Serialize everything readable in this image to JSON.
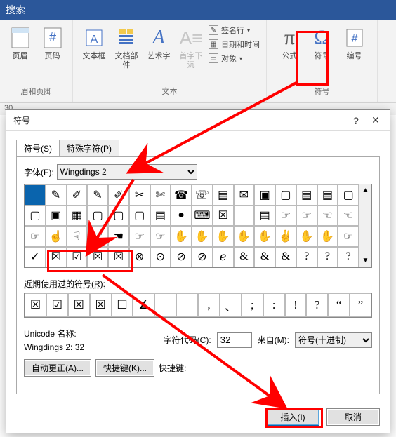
{
  "titlebar": {
    "search_hint": "搜索"
  },
  "ribbon": {
    "g1": {
      "btn1": "页眉",
      "btn2": "页码",
      "label": "眉和页脚"
    },
    "g2": {
      "btn1": "文本框",
      "btn2": "文档部件",
      "btn3": "艺术字",
      "btn4": "首字下沉",
      "m1": "签名行",
      "m2": "日期和时间",
      "m3": "对象",
      "label": "文本"
    },
    "g3": {
      "btn1": "公式",
      "btn2": "符号",
      "btn3": "编号",
      "label": "符号"
    }
  },
  "status": {
    "left": "30"
  },
  "dialog": {
    "title": "符号",
    "help": "?",
    "close": "✕",
    "tabs": {
      "t1": "符号(S)",
      "t2": "特殊字符(P)"
    },
    "font_label": "字体(F):",
    "font_value": "Wingdings 2",
    "grid_symbols": [
      "",
      "✎",
      "✐",
      "✎",
      "✐",
      "✂",
      "✄",
      "☎",
      "☏",
      "▤",
      "✉",
      "▣",
      "▢",
      "▤",
      "▤",
      "▢",
      "▢",
      "▣",
      "▦",
      "▢",
      "▢",
      "▢",
      "▤",
      "●",
      "⌨",
      "☒",
      "",
      "▤",
      "☞",
      "☞",
      "☜",
      "☜",
      "☞",
      "☝",
      "☟",
      "☞",
      "☚",
      "☞",
      "☞",
      "✋",
      "✋",
      "✋",
      "✋",
      "✋",
      "✌",
      "✋",
      "✋",
      "☞",
      "✓",
      "☒",
      "☑",
      "☒",
      "☒",
      "⊗",
      "⊙",
      "⊘",
      "⊘",
      "ℯ",
      "&",
      "&",
      "&",
      "?",
      "?",
      "?"
    ],
    "recent_label": "近期使用过的符号(R):",
    "recent_symbols": [
      "☒",
      "☑",
      "☒",
      "☒",
      "☐",
      "∠",
      "",
      "",
      ",",
      "、",
      ";",
      ":",
      "!",
      "?",
      "“",
      "”"
    ],
    "unicode_name_label": "Unicode 名称:",
    "unicode_name_value": "Wingdings 2: 32",
    "charcode_label": "字符代码(C):",
    "charcode_value": "32",
    "from_label": "来自(M):",
    "from_value": "符号(十进制)",
    "autocorrect": "自动更正(A)...",
    "shortcut": "快捷键(K)...",
    "shortcut_label": "快捷键:",
    "insert": "插入(I)",
    "cancel": "取消"
  }
}
